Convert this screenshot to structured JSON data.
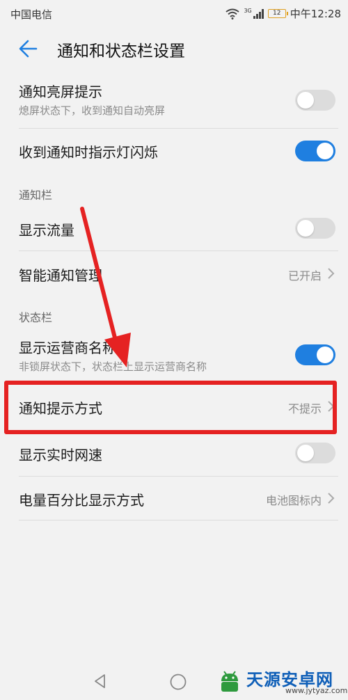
{
  "status_bar": {
    "carrier": "中国电信",
    "network_tag": "3G",
    "battery": "12",
    "time": "中午12:28",
    "battery_color": "#e0a020"
  },
  "header": {
    "back_icon": "back-arrow-icon",
    "title": "通知和状态栏设置"
  },
  "settings": {
    "wake_screen": {
      "label": "通知亮屏提示",
      "sub": "熄屏状态下，收到通知自动亮屏",
      "enabled": false
    },
    "led_blink": {
      "label": "收到通知时指示灯闪烁",
      "enabled": true
    },
    "notification_section": "通知栏",
    "show_traffic": {
      "label": "显示流量",
      "enabled": false
    },
    "smart_notification": {
      "label": "智能通知管理",
      "value": "已开启"
    },
    "status_section": "状态栏",
    "carrier_name": {
      "label": "显示运营商名称",
      "sub": "非锁屏状态下，状态栏上显示运营商名称",
      "enabled": true
    },
    "notify_style": {
      "label": "通知提示方式",
      "value": "不提示"
    },
    "net_speed": {
      "label": "显示实时网速",
      "enabled": false
    },
    "battery_percent": {
      "label": "电量百分比显示方式",
      "value": "电池图标内"
    }
  },
  "annotation": {
    "highlight_color": "#e52222"
  },
  "colors": {
    "toggle_on": "#1f7fe0",
    "toggle_off": "#dcdcdc",
    "background": "#f2f2f2"
  },
  "watermark": {
    "name": "天源安卓网",
    "url": "www.jytyaz.com"
  }
}
